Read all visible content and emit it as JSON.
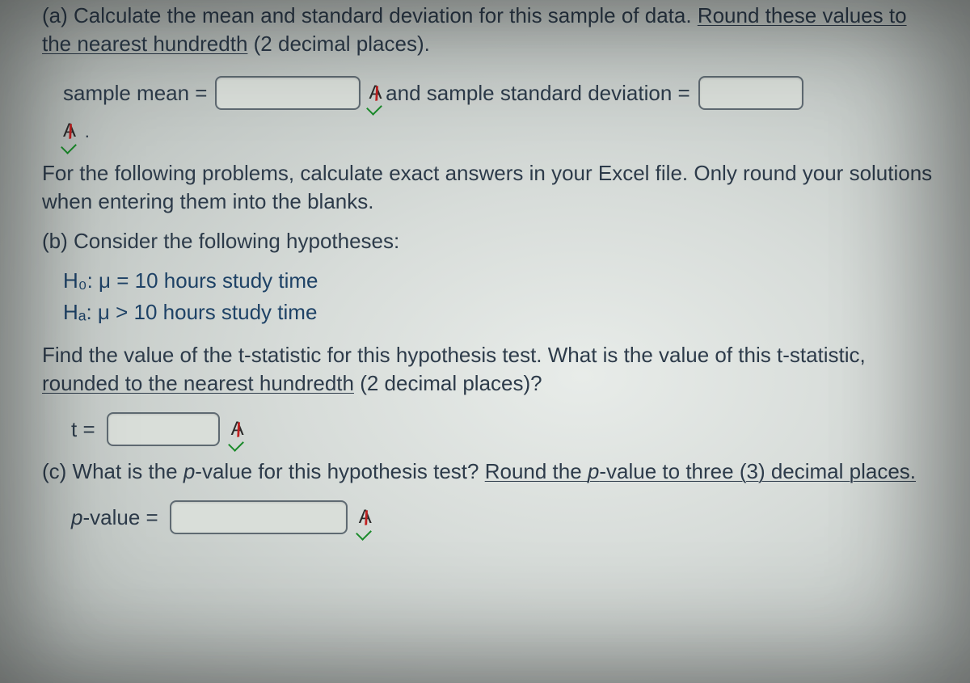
{
  "partA": {
    "prompt_prefix": "(a) Calculate the mean and standard deviation for this sample of data. ",
    "prompt_underlined": "Round these values to the nearest hundredth",
    "prompt_suffix": " (2 decimal places).",
    "sample_mean_label": "sample mean =",
    "and_label": "and sample standard deviation =",
    "sample_mean_value": "",
    "sample_sd_value": "",
    "dot": "."
  },
  "instructions": "For the following problems, calculate exact answers in your Excel file. Only round your solutions when entering them into the blanks.",
  "partB": {
    "intro": "(b) Consider the following hypotheses:",
    "h0": "H₀: μ = 10 hours study time",
    "ha": "Hₐ: μ > 10 hours study time",
    "find_prefix": "Find the value of the t-statistic for this hypothesis test. What is the value of this t-statistic, ",
    "find_underlined": "rounded to the nearest hundredth",
    "find_suffix": " (2 decimal places)?",
    "t_label": "t =",
    "t_value": ""
  },
  "partC": {
    "prompt_prefix": "(c) What is the ",
    "p_italic1": "p",
    "prompt_mid": "-value for this hypothesis test? ",
    "prompt_underlined_a": "Round the ",
    "p_italic2": "p",
    "prompt_underlined_b": "-value to three (3) decimal places.",
    "p_label_prefix": "p",
    "p_label_suffix": "-value =",
    "p_value": ""
  },
  "icon_letter": "A"
}
